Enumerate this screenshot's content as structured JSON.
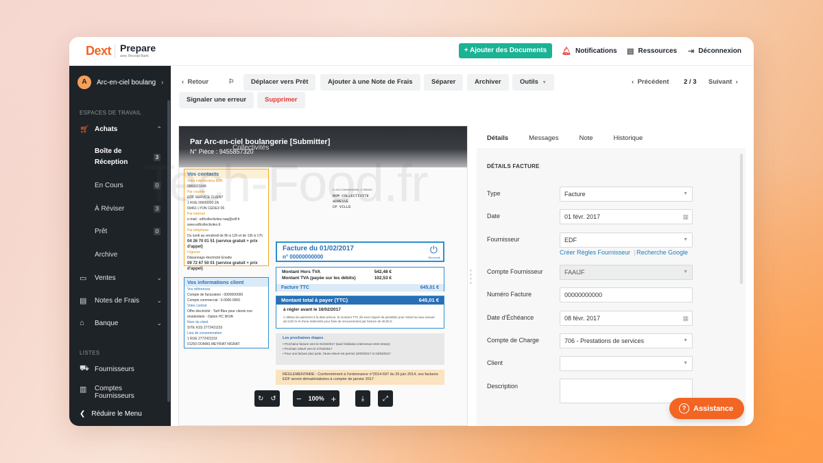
{
  "app": {
    "brand": "Dext",
    "product": "Prepare",
    "product_sub": "avec Receipt Bank"
  },
  "topbar": {
    "add_documents": "+ Ajouter des Documents",
    "notifications": "Notifications",
    "resources": "Ressources",
    "logout": "Déconnexion"
  },
  "sidebar": {
    "account_initial": "A",
    "account_name": "Arc-en-ciel boulang...",
    "workspaces_label": "ESPACES DE TRAVAIL",
    "achats": "Achats",
    "sub": [
      {
        "label": "Boîte de Réception",
        "count": "3"
      },
      {
        "label": "En Cours",
        "count": "0"
      },
      {
        "label": "À Réviser",
        "count": "3"
      },
      {
        "label": "Prêt",
        "count": "0"
      },
      {
        "label": "Archive",
        "count": ""
      }
    ],
    "ventes": "Ventes",
    "notes_frais": "Notes de Frais",
    "banque": "Banque",
    "lists_label": "LISTES",
    "fournisseurs": "Fournisseurs",
    "comptes": "Comptes",
    "comptes_cut": "Fournisseurs",
    "collapse": "Réduire le Menu"
  },
  "toolbar": {
    "back": "Retour",
    "move_ready": "Déplacer vers Prêt",
    "add_expense": "Ajouter à une Note de Frais",
    "split": "Séparer",
    "archive": "Archiver",
    "tools": "Outils",
    "report_error": "Signaler une erreur",
    "delete": "Supprimer",
    "prev": "Précédent",
    "page": "2 / 3",
    "next": "Suivant"
  },
  "document": {
    "submitter": "Par Arc-en-ciel boulangerie [Submitter]",
    "piece": "N° Pièce : 9455857320",
    "edf_overlay": "Collectivités",
    "contacts_title": "Vos contacts",
    "contacts_lines": [
      "Votre interlocuteur EDF",
      "0969321049",
      "Par courrier",
      "EDF SERVICE CLIENT",
      "1 RUE 00000000 ZA",
      "69461 LYON CEDEX 06",
      "Par internet",
      "e-mail : edfcollectivites-naq@edf.fr",
      "www.edfcollectivites.fr",
      "Par téléphone",
      "Du lundi au vendredi de 8h à 12h et de 13h à 17h",
      "04 26 70 01 51 (service gratuit + prix d'appel)",
      "Urgence",
      "Dépannage électricité Enedis",
      "09 72 67 50 01 (service gratuit + prix d'appel)"
    ],
    "info_title": "Vos informations client",
    "info_lines": [
      "Vos références",
      "Compte de facturation : 0000000000",
      "Compte commercial : 0-0000-0000",
      "Votre contrat",
      "Offre électricité : Tarif Bleu pour clients non résidentiels - Option HC 9KVA",
      "Nom du client",
      "SITE KSS 2772431153",
      "Lieu de consommation",
      "1 RUE 2772431153",
      "01250 DOMAS MEYRIAT NIGNAT"
    ],
    "addr_ref": "FLX0170000000000-CTRRA00",
    "addr_lines": [
      "NOM COLLECTIVITE",
      "ADRESSE",
      "CP VILLE"
    ],
    "invoice_title": "Facture du 01/02/2017",
    "invoice_no": "n° 00000000000",
    "plug_label": "Électricité",
    "rows": [
      {
        "label": "Montant Hors TVA",
        "value": "542,48 €"
      },
      {
        "label": "Montant TVA (payée sur les débits)",
        "value": "102,53 €"
      }
    ],
    "ttc_label": "Facture TTC",
    "ttc_value": "645,01 €",
    "pay_label": "Montant total à payer (TTC)",
    "pay_value": "645,01 €",
    "pay_due": "à régler avant le 16/02/2017",
    "pay_fine": "À défaut de paiement à la date prévue, le montant TTC dû sera majoré de pénalités pour retard au taux annuel de 8,00 % et d'une indemnité pour frais de recouvrement par facture de 40,00 €.",
    "next_title": "Les prochaines étapes",
    "next_lines": [
      "• Prochaine facture vers le 01/04/2017 (sauf résiliation intervenue entre temps)",
      "• Prochain relevé vers le 27/03/2017",
      "• Pour une facture plus juste, l'auto-relevé est permis 19/03/2017 et 24/03/2017"
    ],
    "reg_text": "RÉGLEMENTAIRE : Conformément à l'ordonnance n°2014-697 du 26 juin 2014, vos factures EDF seront dématérialisées à compter de janvier 2017",
    "zoom": "100%",
    "watermark": "Tech-Food.fr"
  },
  "panel": {
    "tabs": [
      "Détails",
      "Messages",
      "Note",
      "Historique"
    ],
    "section_title": "DÉTAILS FACTURE",
    "fields": {
      "type_label": "Type",
      "type_value": "Facture",
      "date_label": "Date",
      "date_value": "01 févr. 2017",
      "supplier_label": "Fournisseur",
      "supplier_value": "EDF",
      "rules_link": "Créer Règles Fournisseur",
      "google_link": "Recherche Google",
      "supplier_account_label": "Compte Fournisseur",
      "supplier_account_value": "FAAIJF",
      "invoice_number_label": "Numéro Facture",
      "invoice_number_value": "00000000000",
      "due_date_label": "Date d'Échéance",
      "due_date_value": "08 févr. 2017",
      "charge_account_label": "Compte de Charge",
      "charge_account_value": "706 - Prestations de services",
      "client_label": "Client",
      "client_value": "",
      "description_label": "Description",
      "description_value": ""
    }
  },
  "assistance": "Assistance"
}
